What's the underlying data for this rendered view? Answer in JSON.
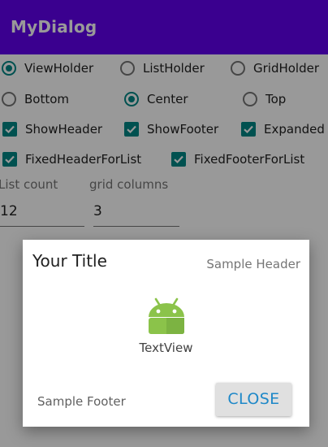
{
  "app": {
    "title": "MyDialog"
  },
  "colors": {
    "primary": "#6200ee",
    "accent": "#018786",
    "button_text": "#1e88c8"
  },
  "layout_radios": [
    {
      "label": "ViewHolder",
      "selected": true
    },
    {
      "label": "ListHolder",
      "selected": false
    },
    {
      "label": "GridHolder",
      "selected": false
    }
  ],
  "gravity_radios": [
    {
      "label": "Bottom",
      "selected": false
    },
    {
      "label": "Center",
      "selected": true
    },
    {
      "label": "Top",
      "selected": false
    }
  ],
  "checkboxes": [
    {
      "label": "ShowHeader",
      "checked": true
    },
    {
      "label": "ShowFooter",
      "checked": true
    },
    {
      "label": "Expanded",
      "checked": true
    },
    {
      "label": "FixedHeaderForList",
      "checked": true
    },
    {
      "label": "FixedFooterForList",
      "checked": true
    }
  ],
  "fields": {
    "list_count": {
      "hint": "List count",
      "value": "12"
    },
    "grid_columns": {
      "hint": "grid columns",
      "value": "3"
    }
  },
  "dialog": {
    "title": "Your Title",
    "header": "Sample Header",
    "icon": "android-icon",
    "text": "TextView",
    "footer": "Sample Footer",
    "close_label": "CLOSE"
  }
}
